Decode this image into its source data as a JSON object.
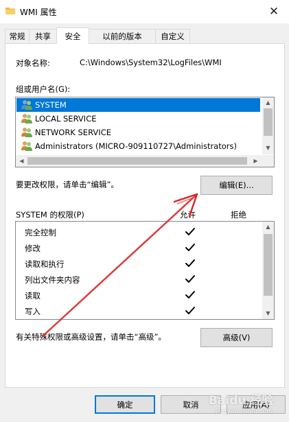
{
  "window": {
    "title": "WMI 属性",
    "close_glyph": "✕"
  },
  "tabs": [
    {
      "label": "常规",
      "active": false
    },
    {
      "label": "共享",
      "active": false
    },
    {
      "label": "安全",
      "active": true
    },
    {
      "label": "以前的版本",
      "active": false
    },
    {
      "label": "自定义",
      "active": false
    }
  ],
  "security": {
    "object_name_label": "对象名称:",
    "object_name_value": "C:\\Windows\\System32\\LogFiles\\WMI",
    "group_label": "组或用户名(G):",
    "users": [
      {
        "name": "SYSTEM",
        "selected": true
      },
      {
        "name": "LOCAL SERVICE",
        "selected": false
      },
      {
        "name": "NETWORK SERVICE",
        "selected": false
      },
      {
        "name": "Administrators (MICRO-909110727\\Administrators)",
        "selected": false
      }
    ],
    "change_hint": "要更改权限，请单击“编辑”。",
    "edit_button": "编辑(E)...",
    "perm_header": "SYSTEM 的权限(P)",
    "allow_header": "允许",
    "deny_header": "拒绝",
    "permissions": [
      {
        "name": "完全控制",
        "allow": true,
        "deny": false
      },
      {
        "name": "修改",
        "allow": true,
        "deny": false
      },
      {
        "name": "读取和执行",
        "allow": true,
        "deny": false
      },
      {
        "name": "列出文件夹内容",
        "allow": true,
        "deny": false
      },
      {
        "name": "读取",
        "allow": true,
        "deny": false
      },
      {
        "name": "写入",
        "allow": true,
        "deny": false
      }
    ],
    "advanced_hint": "有关特殊权限或高级设置，请单击“高级”。",
    "advanced_button": "高级(V)"
  },
  "footer": {
    "ok_button": "确定",
    "cancel_button": "取消",
    "apply_button": "应用(A)"
  },
  "watermark": {
    "text": "Baidu 经验",
    "sub": "jingyan.baidu.com"
  },
  "colors": {
    "selection": "#0078d7",
    "annotation_arrow": "#d42a2a"
  }
}
